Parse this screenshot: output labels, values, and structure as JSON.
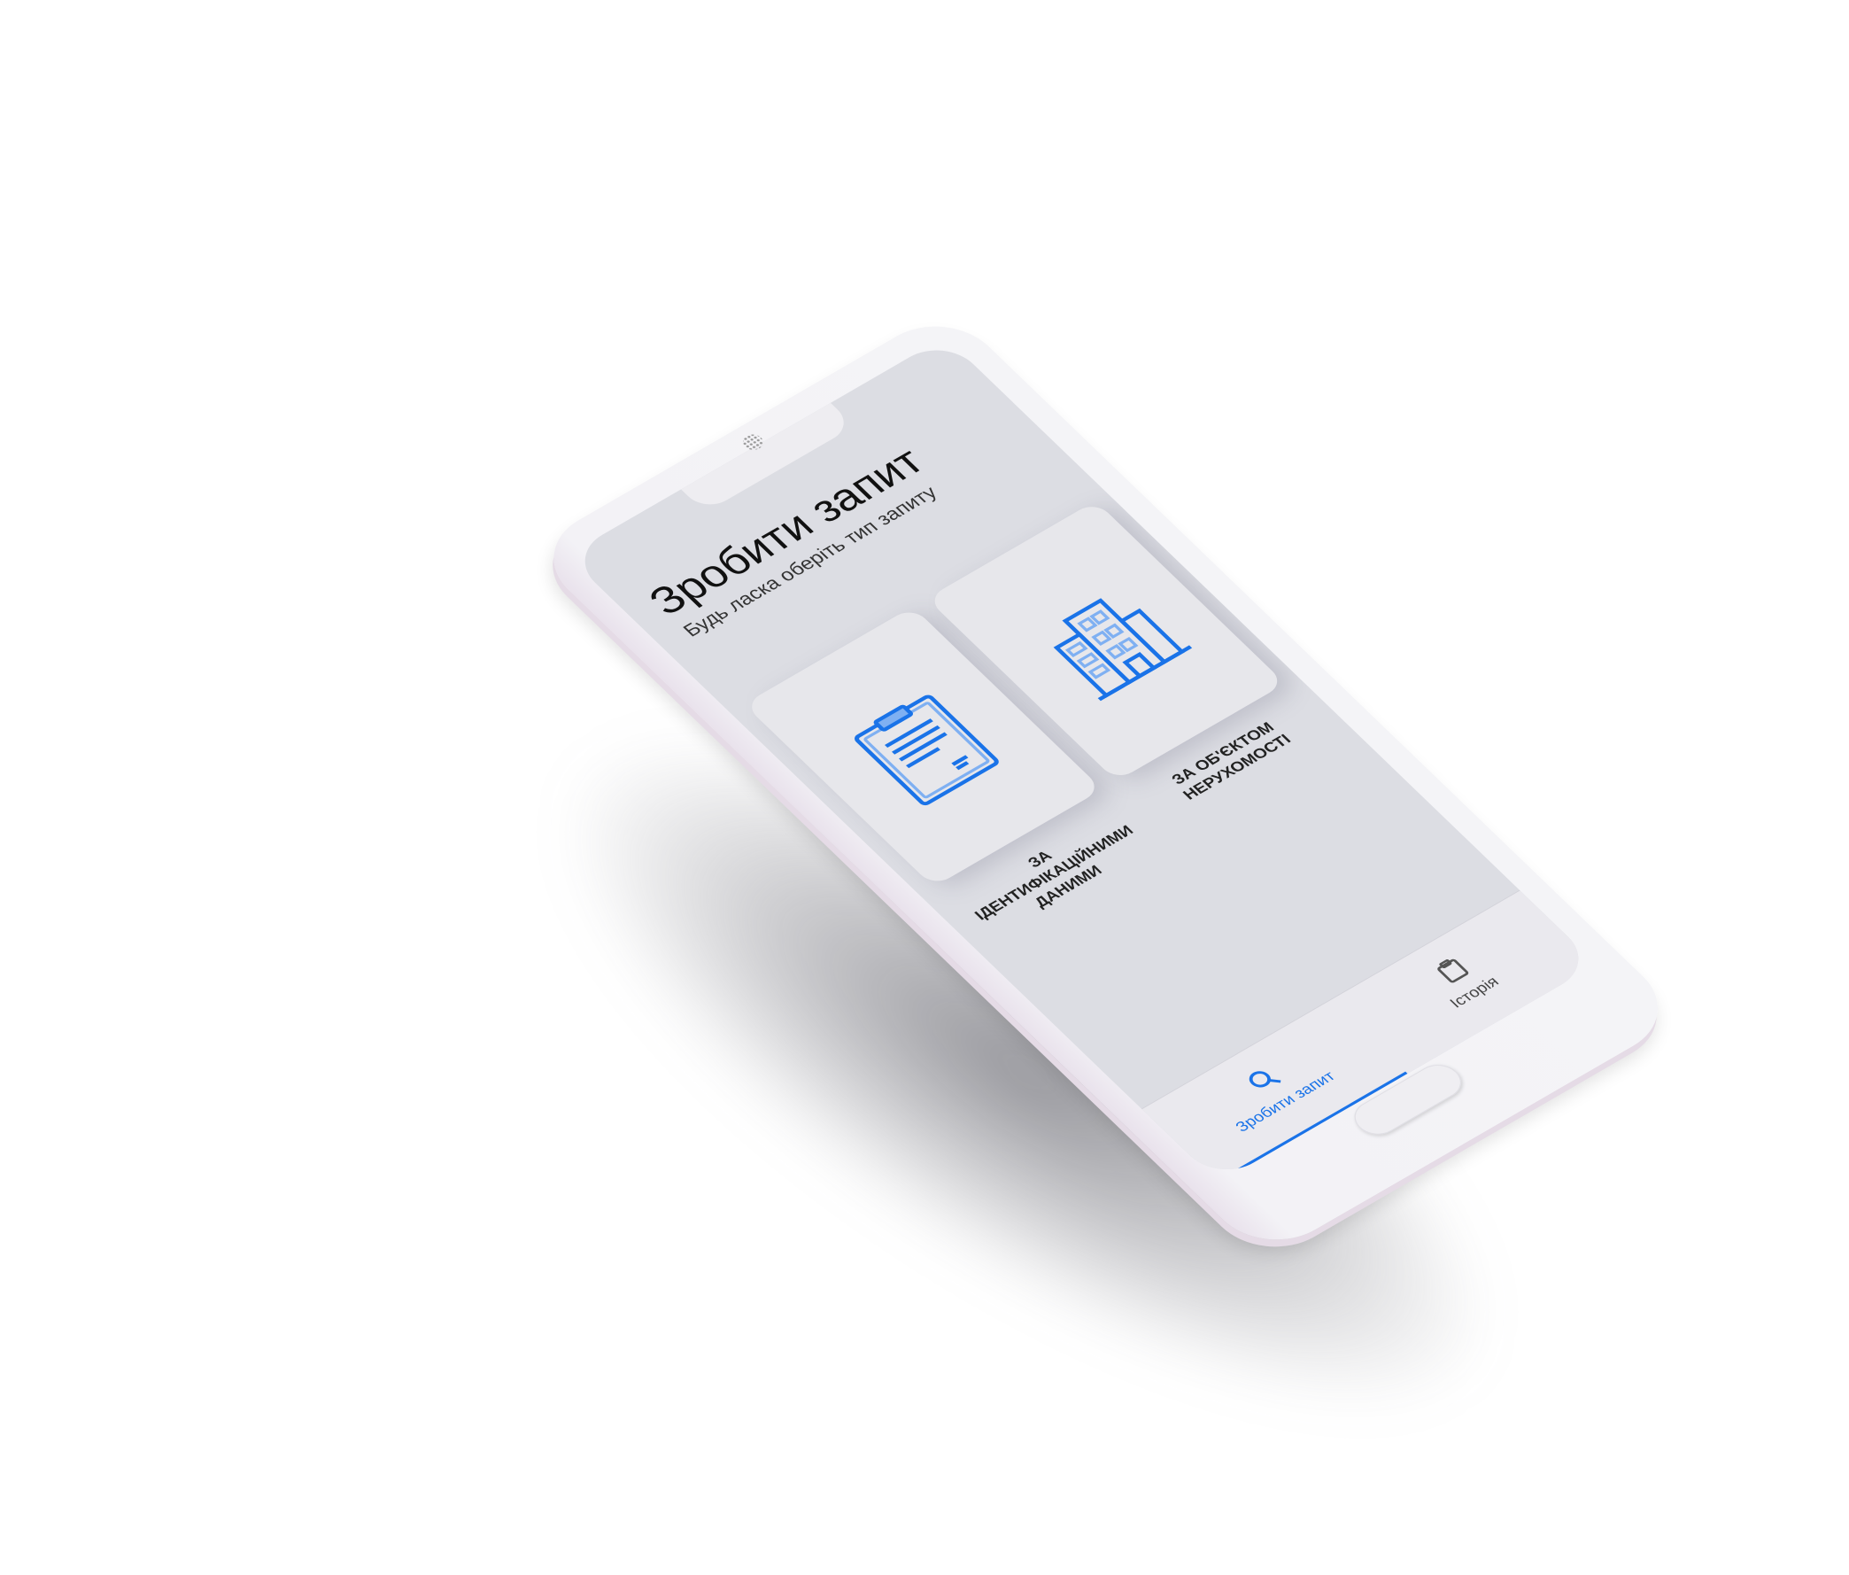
{
  "header": {
    "title": "Зробити запит",
    "subtitle": "Будь ласка оберіть тип запиту"
  },
  "cards": [
    {
      "label": "За ідентифікаційними даними",
      "icon": "document-clipboard-icon"
    },
    {
      "label": "За об'єктом нерухомості",
      "icon": "building-icon"
    }
  ],
  "nav": {
    "tabs": [
      {
        "label": "Зробити запит",
        "icon": "search-icon",
        "active": true
      },
      {
        "label": "Історія",
        "icon": "clipboard-icon",
        "active": false
      }
    ]
  },
  "colors": {
    "accent": "#1a73e8",
    "screen_bg": "#dcdde3",
    "card_bg": "#e7e7eb"
  }
}
